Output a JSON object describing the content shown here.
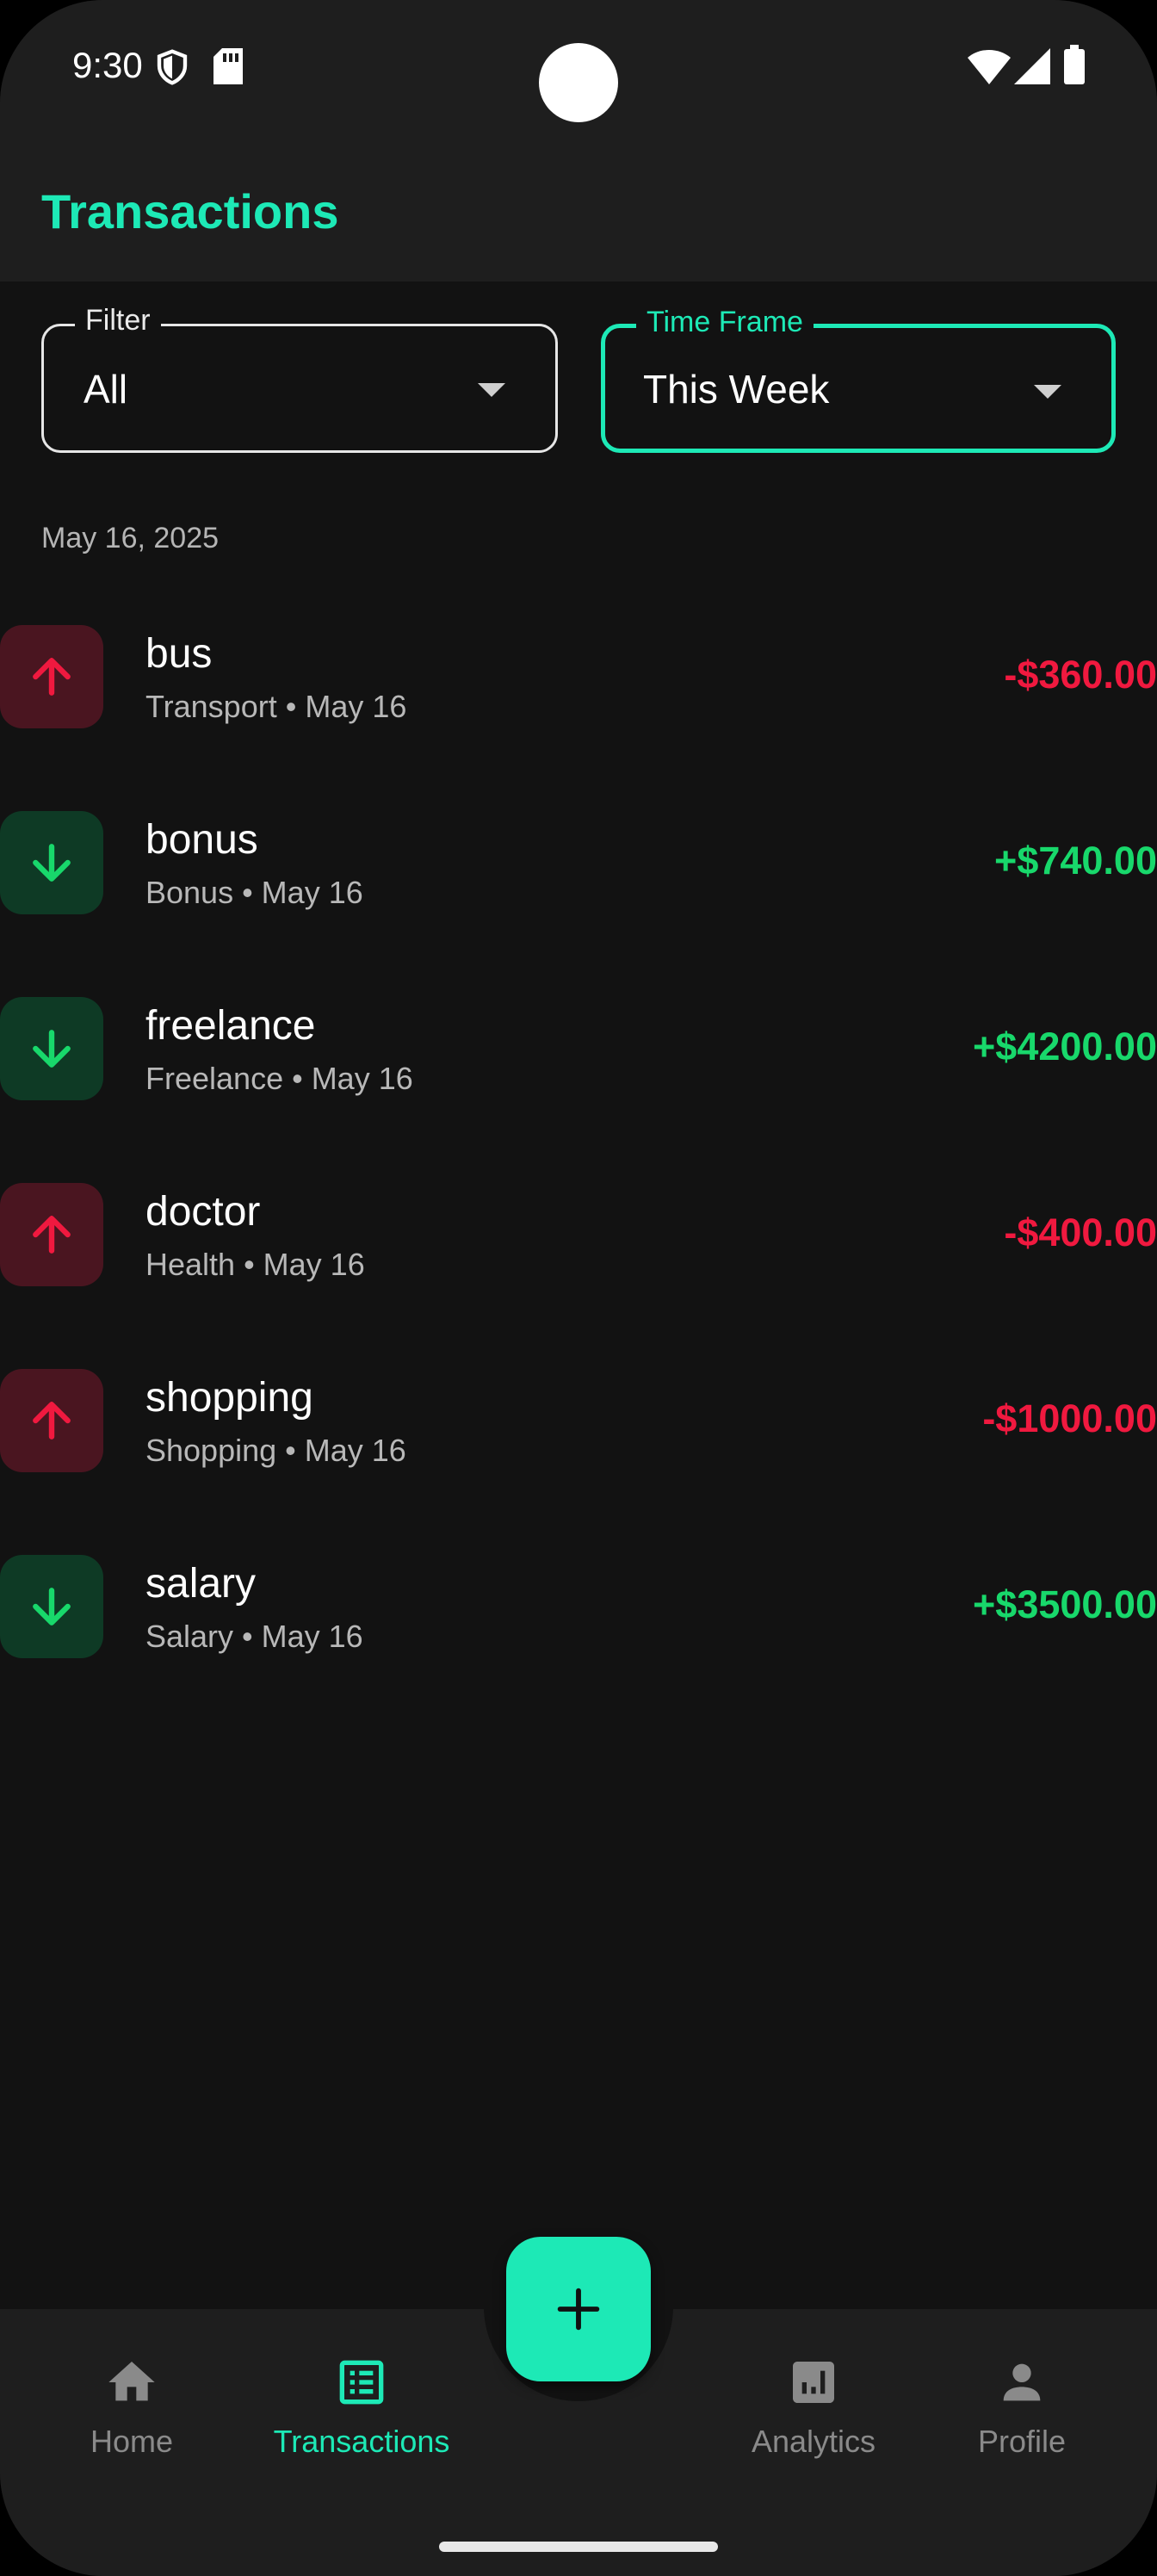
{
  "status_bar": {
    "time": "9:30"
  },
  "app_bar": {
    "title": "Transactions"
  },
  "filters": {
    "filter": {
      "label": "Filter",
      "value": "All"
    },
    "time_frame": {
      "label": "Time Frame",
      "value": "This Week"
    }
  },
  "date_header": "May 16, 2025",
  "transactions": [
    {
      "name": "bus",
      "subtitle": "Transport • May 16",
      "amount": "-$360.00",
      "type": "expense"
    },
    {
      "name": "bonus",
      "subtitle": "Bonus • May 16",
      "amount": "+$740.00",
      "type": "income"
    },
    {
      "name": "freelance",
      "subtitle": "Freelance • May 16",
      "amount": "+$4200.00",
      "type": "income"
    },
    {
      "name": "doctor",
      "subtitle": "Health • May 16",
      "amount": "-$400.00",
      "type": "expense"
    },
    {
      "name": "shopping",
      "subtitle": "Shopping • May 16",
      "amount": "-$1000.00",
      "type": "expense"
    },
    {
      "name": "salary",
      "subtitle": "Salary • May 16",
      "amount": "+$3500.00",
      "type": "income"
    }
  ],
  "bottom_nav": {
    "items": [
      {
        "label": "Home",
        "icon": "home-icon"
      },
      {
        "label": "Transactions",
        "icon": "receipt-list-icon"
      },
      {
        "label": "Analytics",
        "icon": "analytics-icon"
      },
      {
        "label": "Profile",
        "icon": "person-icon"
      }
    ],
    "active": "Transactions",
    "fab_icon": "add-icon"
  },
  "colors": {
    "accent": "#1de9b6",
    "expense": "#f0193f",
    "income": "#18d86b",
    "background": "#121212",
    "surface": "#1e1e1e"
  }
}
